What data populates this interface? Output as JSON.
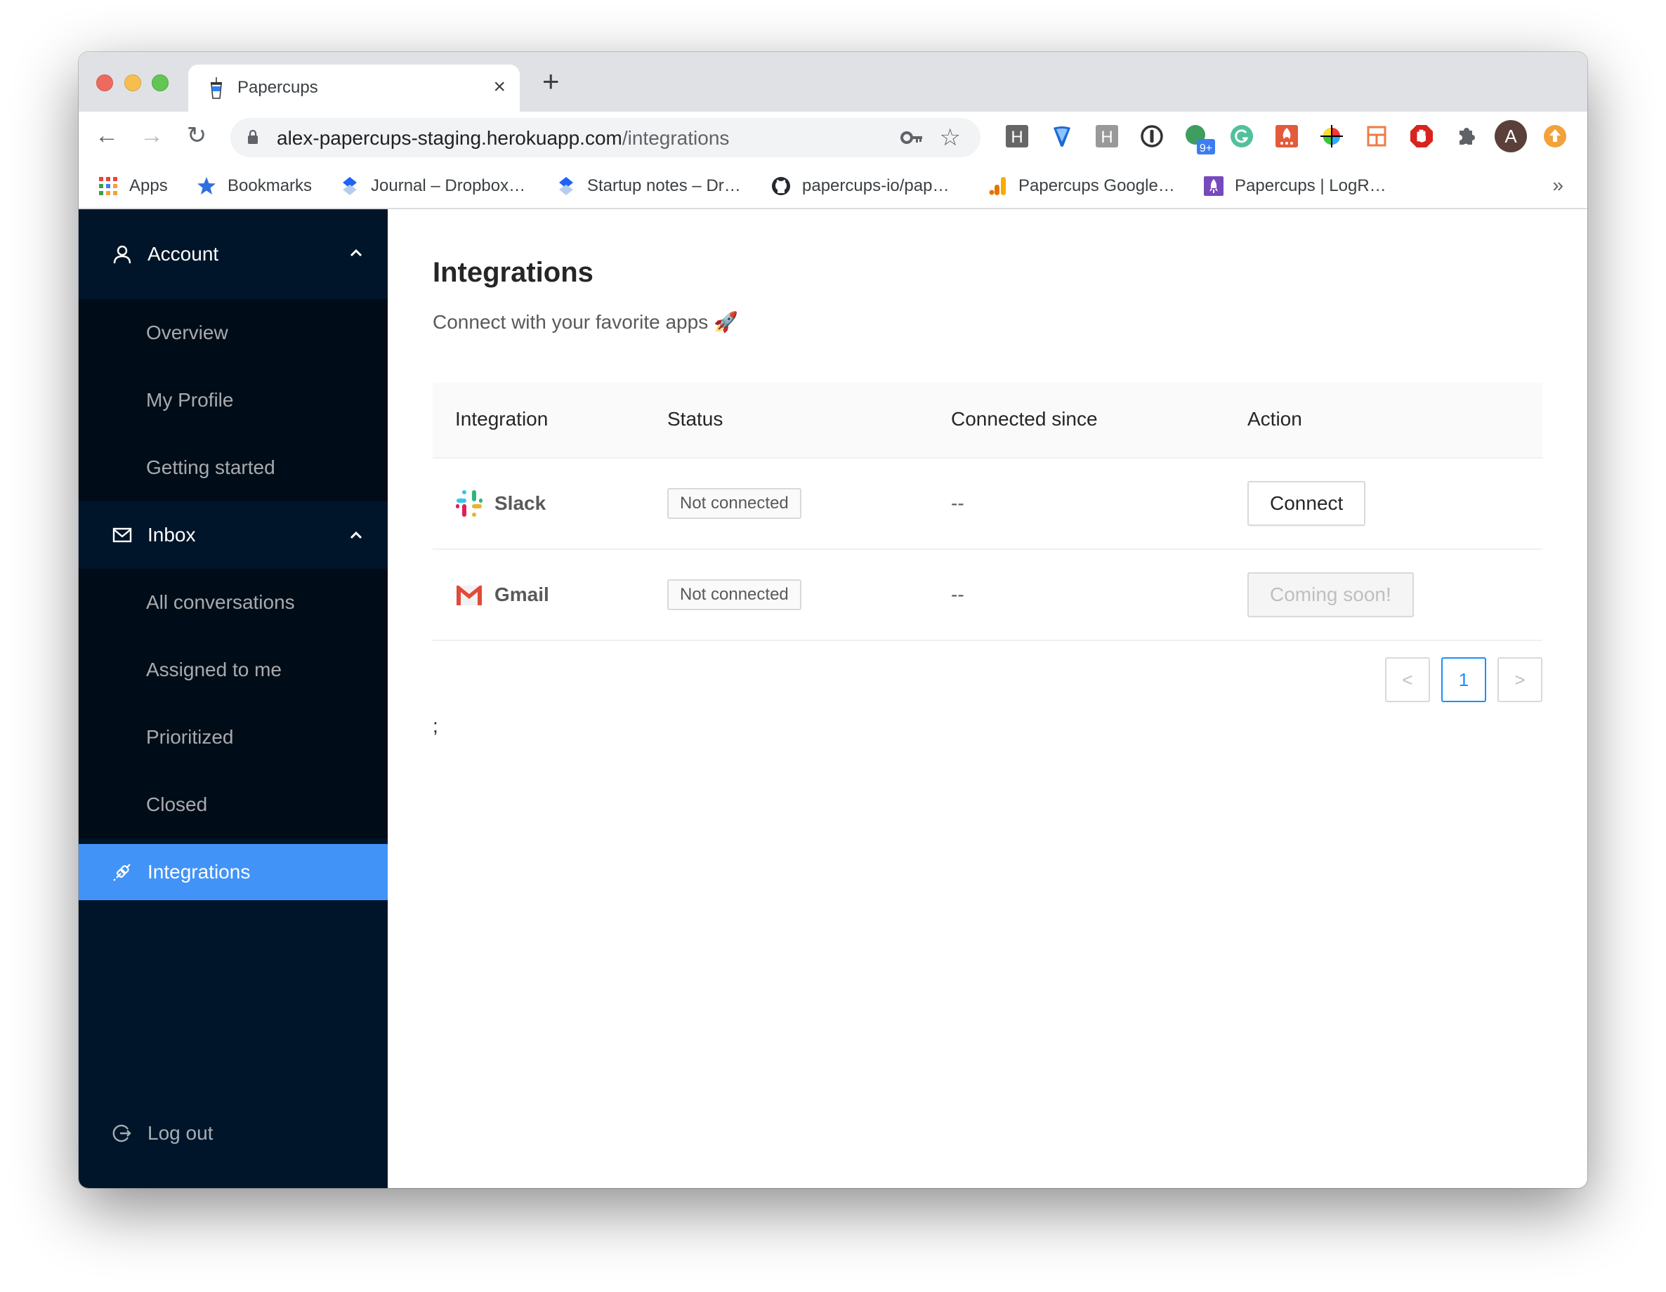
{
  "browser": {
    "tab": {
      "title": "Papercups",
      "favicon": "papercups-cup-icon",
      "close": "×"
    },
    "new_tab": "+",
    "url": {
      "host": "alex-papercups-staging.herokuapp.com",
      "path": "/integrations"
    },
    "nav": {
      "back": "←",
      "forward": "→",
      "reload": "↻"
    },
    "extensions": [
      "honey-h-icon",
      "vimeo-v-icon",
      "hypothesis-h-icon",
      "onepassword-icon",
      "green-circle-badge-icon",
      "grammarly-icon",
      "fire-extension-icon",
      "color-picker-icon",
      "layout-extension-icon",
      "adblock-hand-icon",
      "extensions-puzzle-icon",
      "profile-avatar",
      "update-arrow-icon"
    ],
    "extension_badge": "9+",
    "profile_initial": "A",
    "bookmarks": [
      {
        "label": "Apps",
        "icon": "apps-grid-icon"
      },
      {
        "label": "Bookmarks",
        "icon": "star-icon"
      },
      {
        "label": "Journal – Dropbox…",
        "icon": "dropbox-paper-icon"
      },
      {
        "label": "Startup notes – Dr…",
        "icon": "dropbox-paper-icon"
      },
      {
        "label": "papercups-io/pap…",
        "icon": "github-icon"
      },
      {
        "label": "Papercups Google…",
        "icon": "google-analytics-icon"
      },
      {
        "label": "Papercups | LogR…",
        "icon": "logrocket-icon"
      }
    ],
    "bookmarks_overflow": "»"
  },
  "sidebar": {
    "groups": [
      {
        "label": "Account",
        "icon": "user-icon",
        "expanded": true,
        "items": [
          "Overview",
          "My Profile",
          "Getting started"
        ]
      },
      {
        "label": "Inbox",
        "icon": "mail-icon",
        "expanded": true,
        "items": [
          "All conversations",
          "Assigned to me",
          "Prioritized",
          "Closed"
        ]
      }
    ],
    "active_item": {
      "label": "Integrations",
      "icon": "plug-icon"
    },
    "logout": {
      "label": "Log out",
      "icon": "logout-icon"
    },
    "colors": {
      "bg": "#001529",
      "sub_bg": "#000c17",
      "active": "#4293f7"
    }
  },
  "main": {
    "title": "Integrations",
    "subtitle": "Connect with your favorite apps 🚀",
    "table": {
      "columns": [
        "Integration",
        "Status",
        "Connected since",
        "Action"
      ],
      "rows": [
        {
          "name": "Slack",
          "logo": "slack-logo-icon",
          "status": "Not connected",
          "connected_since": "--",
          "action": "Connect",
          "action_disabled": false
        },
        {
          "name": "Gmail",
          "logo": "gmail-logo-icon",
          "status": "Not connected",
          "connected_since": "--",
          "action": "Coming soon!",
          "action_disabled": true
        }
      ]
    },
    "pagination": {
      "prev": "<",
      "current": "1",
      "next": ">"
    },
    "stray_text": ";"
  }
}
